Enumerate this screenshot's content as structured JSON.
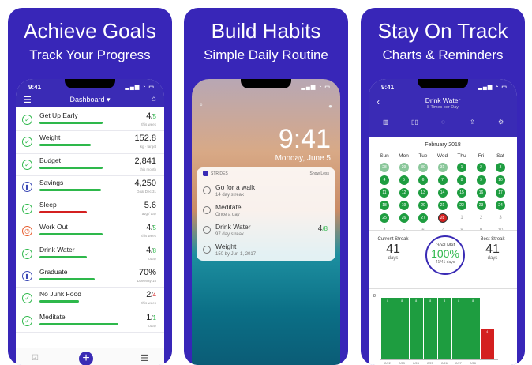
{
  "panels": [
    {
      "title": "Achieve Goals",
      "subtitle": "Track Your Progress"
    },
    {
      "title": "Build Habits",
      "subtitle": "Simple Daily Routine"
    },
    {
      "title": "Stay On Track",
      "subtitle": "Charts & Reminders"
    }
  ],
  "status_time": "9:41",
  "dashboard": {
    "nav_title": "Dashboard",
    "habits": [
      {
        "name": "Get Up Early",
        "value": "4",
        "total": "5",
        "sub": "this week",
        "progress": 0.8,
        "icon": "check-icon",
        "bar": "green",
        "tot_color": "green"
      },
      {
        "name": "Weight",
        "value": "152.8",
        "total": "",
        "sub": "kg · target",
        "progress": 0.65,
        "icon": "check-icon",
        "bar": "green",
        "tot_color": ""
      },
      {
        "name": "Budget",
        "value": "2,841",
        "total": "",
        "sub": "this month",
        "progress": 0.8,
        "icon": "check-icon",
        "bar": "green",
        "tot_color": ""
      },
      {
        "name": "Savings",
        "value": "4,250",
        "total": "",
        "sub": "Goal Dec 31",
        "progress": 0.78,
        "icon": "chart-icon",
        "bar": "green",
        "tot_color": ""
      },
      {
        "name": "Sleep",
        "value": "5.6",
        "total": "",
        "sub": "avg / day",
        "progress": 0.6,
        "icon": "check-icon",
        "bar": "red",
        "tot_color": ""
      },
      {
        "name": "Work Out",
        "value": "4",
        "total": "5",
        "sub": "this week",
        "progress": 0.8,
        "icon": "alarm-icon",
        "bar": "green",
        "tot_color": "green"
      },
      {
        "name": "Drink Water",
        "value": "4",
        "total": "8",
        "sub": "today",
        "progress": 0.6,
        "icon": "check-icon",
        "bar": "green",
        "tot_color": "green"
      },
      {
        "name": "Graduate",
        "value": "70%",
        "total": "",
        "sub": "Due May 15",
        "progress": 0.7,
        "icon": "chart-icon",
        "bar": "green",
        "tot_color": ""
      },
      {
        "name": "No Junk Food",
        "value": "2",
        "total": "4",
        "sub": "this week",
        "progress": 0.5,
        "icon": "check-icon",
        "bar": "green",
        "tot_color": "red"
      },
      {
        "name": "Meditate",
        "value": "1",
        "total": "1",
        "sub": "today",
        "progress": 1.0,
        "icon": "check-icon",
        "bar": "green",
        "tot_color": "green"
      }
    ]
  },
  "lockscreen": {
    "time": "9:41",
    "date": "Monday, June 5",
    "widget_app": "STRIDES",
    "widget_more": "Show Less",
    "items": [
      {
        "name": "Go for a walk",
        "sub": "14 day streak",
        "value": "",
        "total": ""
      },
      {
        "name": "Meditate",
        "sub": "Once a day",
        "value": "",
        "total": ""
      },
      {
        "name": "Drink Water",
        "sub": "97 day streak",
        "value": "4",
        "total": "8"
      },
      {
        "name": "Weight",
        "sub": "150 by Jun 1, 2017",
        "value": "",
        "total": ""
      }
    ]
  },
  "detail": {
    "title": "Drink Water",
    "subtitle": "8 Times per Day",
    "month": "February 2018",
    "dow": [
      "Sun",
      "Mon",
      "Tue",
      "Wed",
      "Thu",
      "Fri",
      "Sat"
    ],
    "weeks": [
      [
        "28",
        "29",
        "30",
        "31",
        "1",
        "2",
        "3"
      ],
      [
        "4",
        "5",
        "6",
        "7",
        "8",
        "9",
        "10"
      ],
      [
        "11",
        "12",
        "13",
        "14",
        "15",
        "16",
        "17"
      ],
      [
        "18",
        "19",
        "20",
        "21",
        "22",
        "23",
        "24"
      ],
      [
        "25",
        "26",
        "27",
        "28",
        "1",
        "2",
        "3"
      ],
      [
        "4",
        "5",
        "6",
        "7",
        "8",
        "9",
        "10"
      ]
    ],
    "current_streak_label": "Current Streak",
    "current_streak": "41",
    "best_streak_label": "Best Streak",
    "best_streak": "41",
    "days_label": "days",
    "goal_label": "Goal Met",
    "goal_pct": "100%",
    "goal_sub": "41/41 days",
    "chart_ymax": "8",
    "bar_values": [
      8,
      8,
      8,
      8,
      8,
      8,
      8,
      4
    ],
    "bar_labels": [
      "8",
      "8",
      "8",
      "8",
      "8",
      "8",
      "8",
      "4"
    ],
    "bar_dates": [
      "2/22",
      "2/23",
      "2/24",
      "2/25",
      "2/26",
      "2/27",
      "2/28",
      ""
    ],
    "colors": {
      "green": "#1e9d40",
      "red": "#d42020",
      "brand": "#3826b8"
    }
  }
}
